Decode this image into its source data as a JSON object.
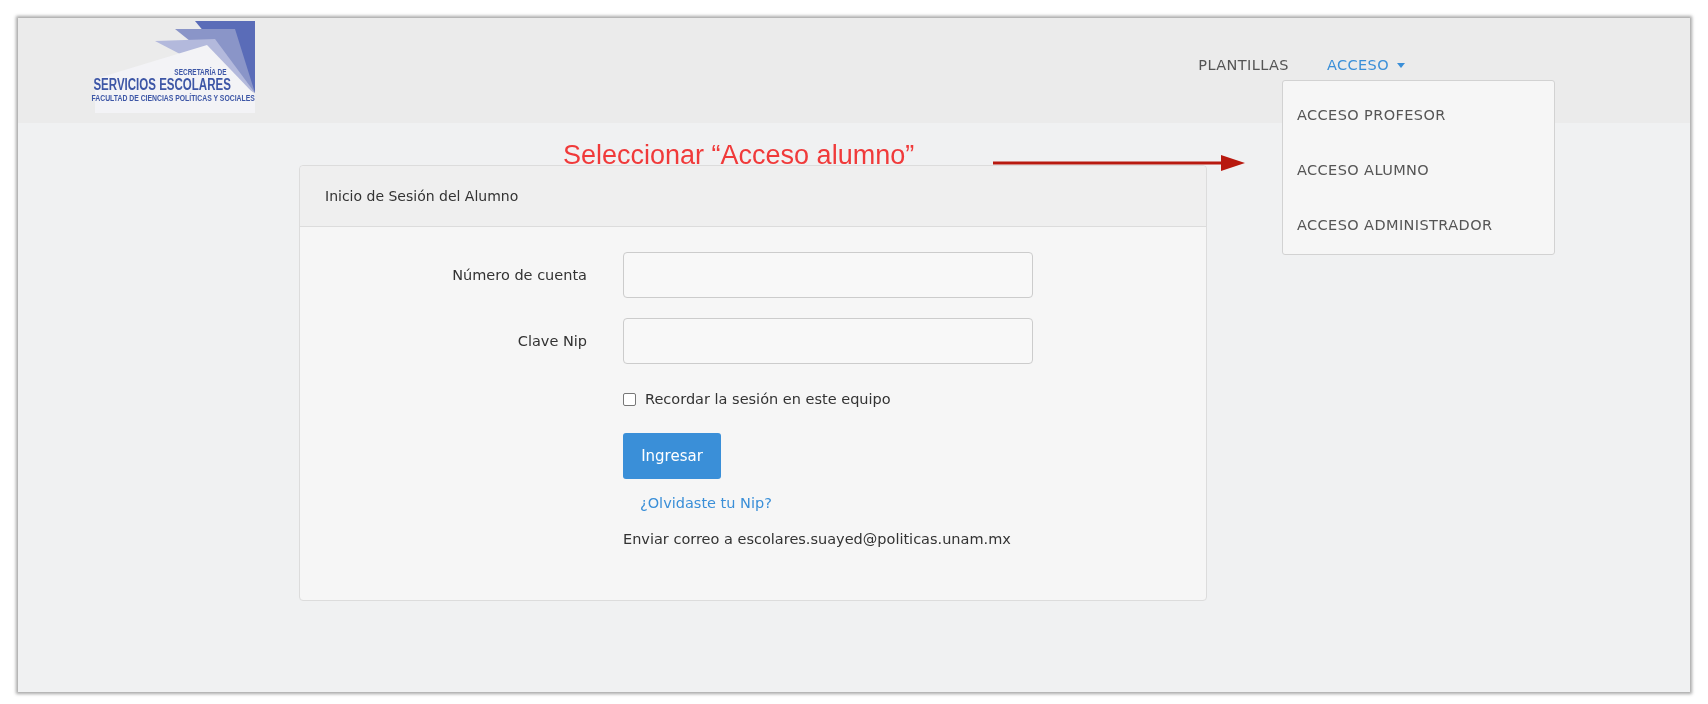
{
  "logo": {
    "lines": [
      "SECRETARÍA DE",
      "SERVICIOS ESCOLARES",
      "FACULTAD DE CIENCIAS POLÍTICAS Y SOCIALES"
    ]
  },
  "nav": {
    "items": [
      {
        "label": "PLANTILLAS",
        "kind": "link",
        "selected": false
      },
      {
        "label": "ACCESO",
        "kind": "dropdown",
        "selected": true
      }
    ]
  },
  "dropdown": {
    "items": [
      {
        "label": "ACCESO PROFESOR"
      },
      {
        "label": "ACCESO ALUMNO"
      },
      {
        "label": "ACCESO ADMINISTRADOR"
      }
    ]
  },
  "annotation": {
    "text": "Seleccionar “Acceso alumno”"
  },
  "login_card": {
    "title": "Inicio de Sesión del Alumno",
    "fields": [
      {
        "label": "Número de cuenta"
      },
      {
        "label": "Clave Nip"
      }
    ],
    "remember": {
      "label": "Recordar la sesión en este equipo",
      "checked": false
    },
    "submit": "Ingresar",
    "forgot_link": "¿Olvidaste tu Nip?",
    "contact": "Enviar correo a escolares.suayed@politicas.unam.mx"
  }
}
